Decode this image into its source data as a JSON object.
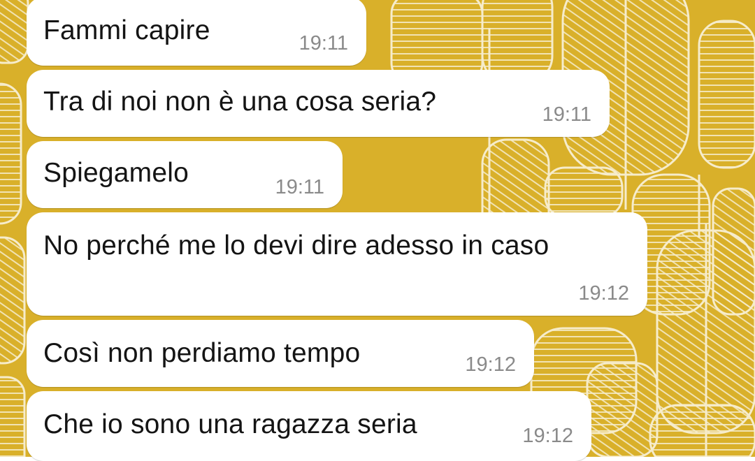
{
  "wallpaper": {
    "base_color": "#d9b02a",
    "pattern_color": "#f6eccb"
  },
  "bubble_color": "#ffffff",
  "messages": [
    {
      "text": "Fammi capire",
      "time": "19:11"
    },
    {
      "text": "Tra di noi non è una cosa seria?",
      "time": "19:11"
    },
    {
      "text": "Spiegamelo",
      "time": "19:11"
    },
    {
      "text": "No perché me lo devi dire adesso in caso",
      "time": "19:12"
    },
    {
      "text": "Così non perdiamo tempo",
      "time": "19:12"
    },
    {
      "text": "Che io sono una ragazza seria",
      "time": "19:12"
    }
  ]
}
